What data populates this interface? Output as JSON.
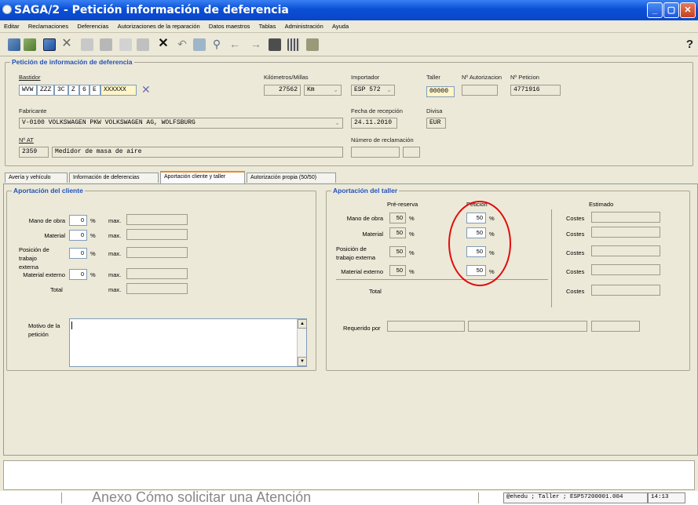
{
  "window": {
    "title": "SAGA/2 - Petición información de deferencia",
    "minimize": "_",
    "maximize": "▢",
    "close": "✕"
  },
  "menu": [
    "Editar",
    "Reclamaciones",
    "Deferencias",
    "Autorizaciones de la reparación",
    "Datos maestros",
    "Tablas",
    "Administración",
    "Ayuda"
  ],
  "help": "?",
  "header": {
    "title": "Petición de información de deferencia",
    "bastidor": {
      "label": "Bastidor",
      "parts": [
        "WVW",
        "ZZZ",
        "3C",
        "Z",
        "6",
        "E",
        "XXXXXX"
      ],
      "clear": "✕"
    },
    "km": {
      "label": "Kilómetros/Millas",
      "value": "27562",
      "unit": "Km"
    },
    "importador": {
      "label": "Importador",
      "value": "ESP 572"
    },
    "taller": {
      "label": "Taller",
      "value": "00000"
    },
    "n_autorizacion": {
      "label": "Nº Autorizacion",
      "value": ""
    },
    "n_peticion": {
      "label": "Nº Peticion",
      "value": "4771916"
    },
    "fabricante": {
      "label": "Fabricante",
      "value": "V-0100 VOLKSWAGEN PKW VOLKSWAGEN AG, WOLFSBURG"
    },
    "fecha_recepcion": {
      "label": "Fecha de recepción",
      "value": "24.11.2010"
    },
    "divisa": {
      "label": "Divisa",
      "value": "EUR"
    },
    "n_at": {
      "label": "Nº AT",
      "code": "2359",
      "desc": "Medidor de masa de aire"
    },
    "n_reclamacion": {
      "label": "Número de reclamación",
      "value": ""
    }
  },
  "tabs": [
    "Avería y vehículo",
    "Información de deferencias",
    "Aportación cliente y taller",
    "Autorización propia (50/50)"
  ],
  "cliente": {
    "title": "Aportación del cliente",
    "rows": [
      {
        "label": "Mano de obra",
        "value": "0",
        "pct": "%",
        "max": "max."
      },
      {
        "label": "Material",
        "value": "0",
        "pct": "%",
        "max": "max."
      },
      {
        "label": "Posición de trabajo externa",
        "value": "0",
        "pct": "%",
        "max": "max."
      },
      {
        "label": "Material externo",
        "value": "0",
        "pct": "%",
        "max": "max."
      }
    ],
    "total": {
      "label": "Total",
      "max": "max."
    },
    "motivo_label": "Motivo de la petición"
  },
  "taller": {
    "title": "Aportación del taller",
    "col_prereserva": "Pré-reserva",
    "col_peticion": "Petición",
    "col_estimado": "Estimado",
    "rows": [
      {
        "label": "Mano de obra",
        "pre": "50",
        "pct1": "%",
        "pet": "50",
        "pct2": "%",
        "costes": "Costes"
      },
      {
        "label": "Material",
        "pre": "50",
        "pct1": "%",
        "pet": "50",
        "pct2": "%",
        "costes": "Costes"
      },
      {
        "label": "Posición de trabajo externa",
        "pre": "50",
        "pct1": "%",
        "pet": "50",
        "pct2": "%",
        "costes": "Costes"
      },
      {
        "label": "Material externo",
        "pre": "50",
        "pct1": "%",
        "pet": "50",
        "pct2": "%",
        "costes": "Costes"
      }
    ],
    "total": {
      "label": "Total",
      "costes": "Costes"
    },
    "requerido_label": "Requerido por"
  },
  "overlay_text": "Anexo Cómo solicitar una Atención",
  "status": {
    "session": "@ehedu ; Taller ; ESP57200001.004",
    "time": "14:13"
  }
}
